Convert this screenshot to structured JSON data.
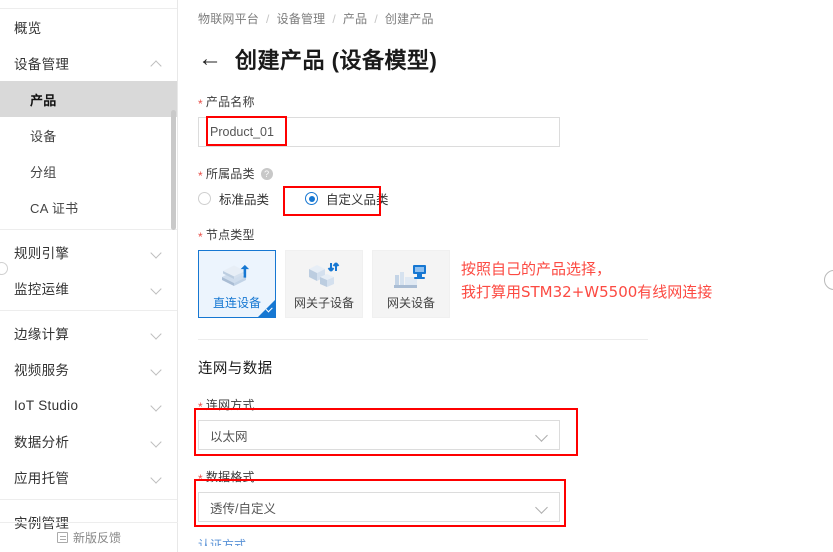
{
  "sidebar": {
    "items": [
      {
        "label": "概览",
        "type": "group",
        "chevron": "none",
        "active": false
      },
      {
        "label": "设备管理",
        "type": "group",
        "chevron": "up",
        "active": false
      },
      {
        "label": "产品",
        "type": "child",
        "chevron": "none",
        "active": true
      },
      {
        "label": "设备",
        "type": "child",
        "chevron": "none",
        "active": false
      },
      {
        "label": "分组",
        "type": "child",
        "chevron": "none",
        "active": false
      },
      {
        "label": "CA 证书",
        "type": "child",
        "chevron": "none",
        "active": false
      },
      {
        "label": "规则引擎",
        "type": "group",
        "chevron": "down",
        "active": false
      },
      {
        "label": "监控运维",
        "type": "group",
        "chevron": "down",
        "active": false
      },
      {
        "label": "边缘计算",
        "type": "group",
        "chevron": "down",
        "active": false
      },
      {
        "label": "视频服务",
        "type": "group",
        "chevron": "down",
        "active": false
      },
      {
        "label": "IoT Studio",
        "type": "group",
        "chevron": "down",
        "active": false
      },
      {
        "label": "数据分析",
        "type": "group",
        "chevron": "down",
        "active": false
      },
      {
        "label": "应用托管",
        "type": "group",
        "chevron": "down",
        "active": false
      },
      {
        "label": "实例管理",
        "type": "group",
        "chevron": "none",
        "active": false
      }
    ],
    "footer_label": "新版反馈"
  },
  "breadcrumb": {
    "items": [
      "物联网平台",
      "设备管理",
      "产品",
      "创建产品"
    ],
    "separator": "/"
  },
  "header": {
    "back_arrow": "←",
    "title": "创建产品 (设备模型)"
  },
  "form": {
    "product_name": {
      "label": "产品名称",
      "required_mark": "*",
      "value": "Product_01",
      "placeholder": ""
    },
    "category": {
      "label": "所属品类",
      "required_mark": "*",
      "help_glyph": "?",
      "options": [
        {
          "label": "标准品类",
          "selected": false
        },
        {
          "label": "自定义品类",
          "selected": true
        }
      ]
    },
    "node_type": {
      "label": "节点类型",
      "required_mark": "*",
      "cards": [
        {
          "label": "直连设备",
          "selected": true,
          "icon": "direct-device-icon"
        },
        {
          "label": "网关子设备",
          "selected": false,
          "icon": "gateway-subdevice-icon"
        },
        {
          "label": "网关设备",
          "selected": false,
          "icon": "gateway-device-icon"
        }
      ]
    },
    "section_network": {
      "title": "连网与数据",
      "net_method": {
        "label": "连网方式",
        "required_mark": "*",
        "value": "以太网"
      },
      "data_format": {
        "label": "数据格式",
        "required_mark": "*",
        "value": "透传/自定义"
      },
      "auth_method": {
        "label": "认证方式"
      }
    }
  },
  "annotation": {
    "line1": "按照自己的产品选择，",
    "line2": "我打算用STM32+W5500有线网连接",
    "color": "#fc4a42"
  },
  "colors": {
    "accent_blue": "#1677d2",
    "annotation_red": "#fe0000",
    "required_red": "#e8504a",
    "active_item_bg": "#d9d9d9"
  }
}
